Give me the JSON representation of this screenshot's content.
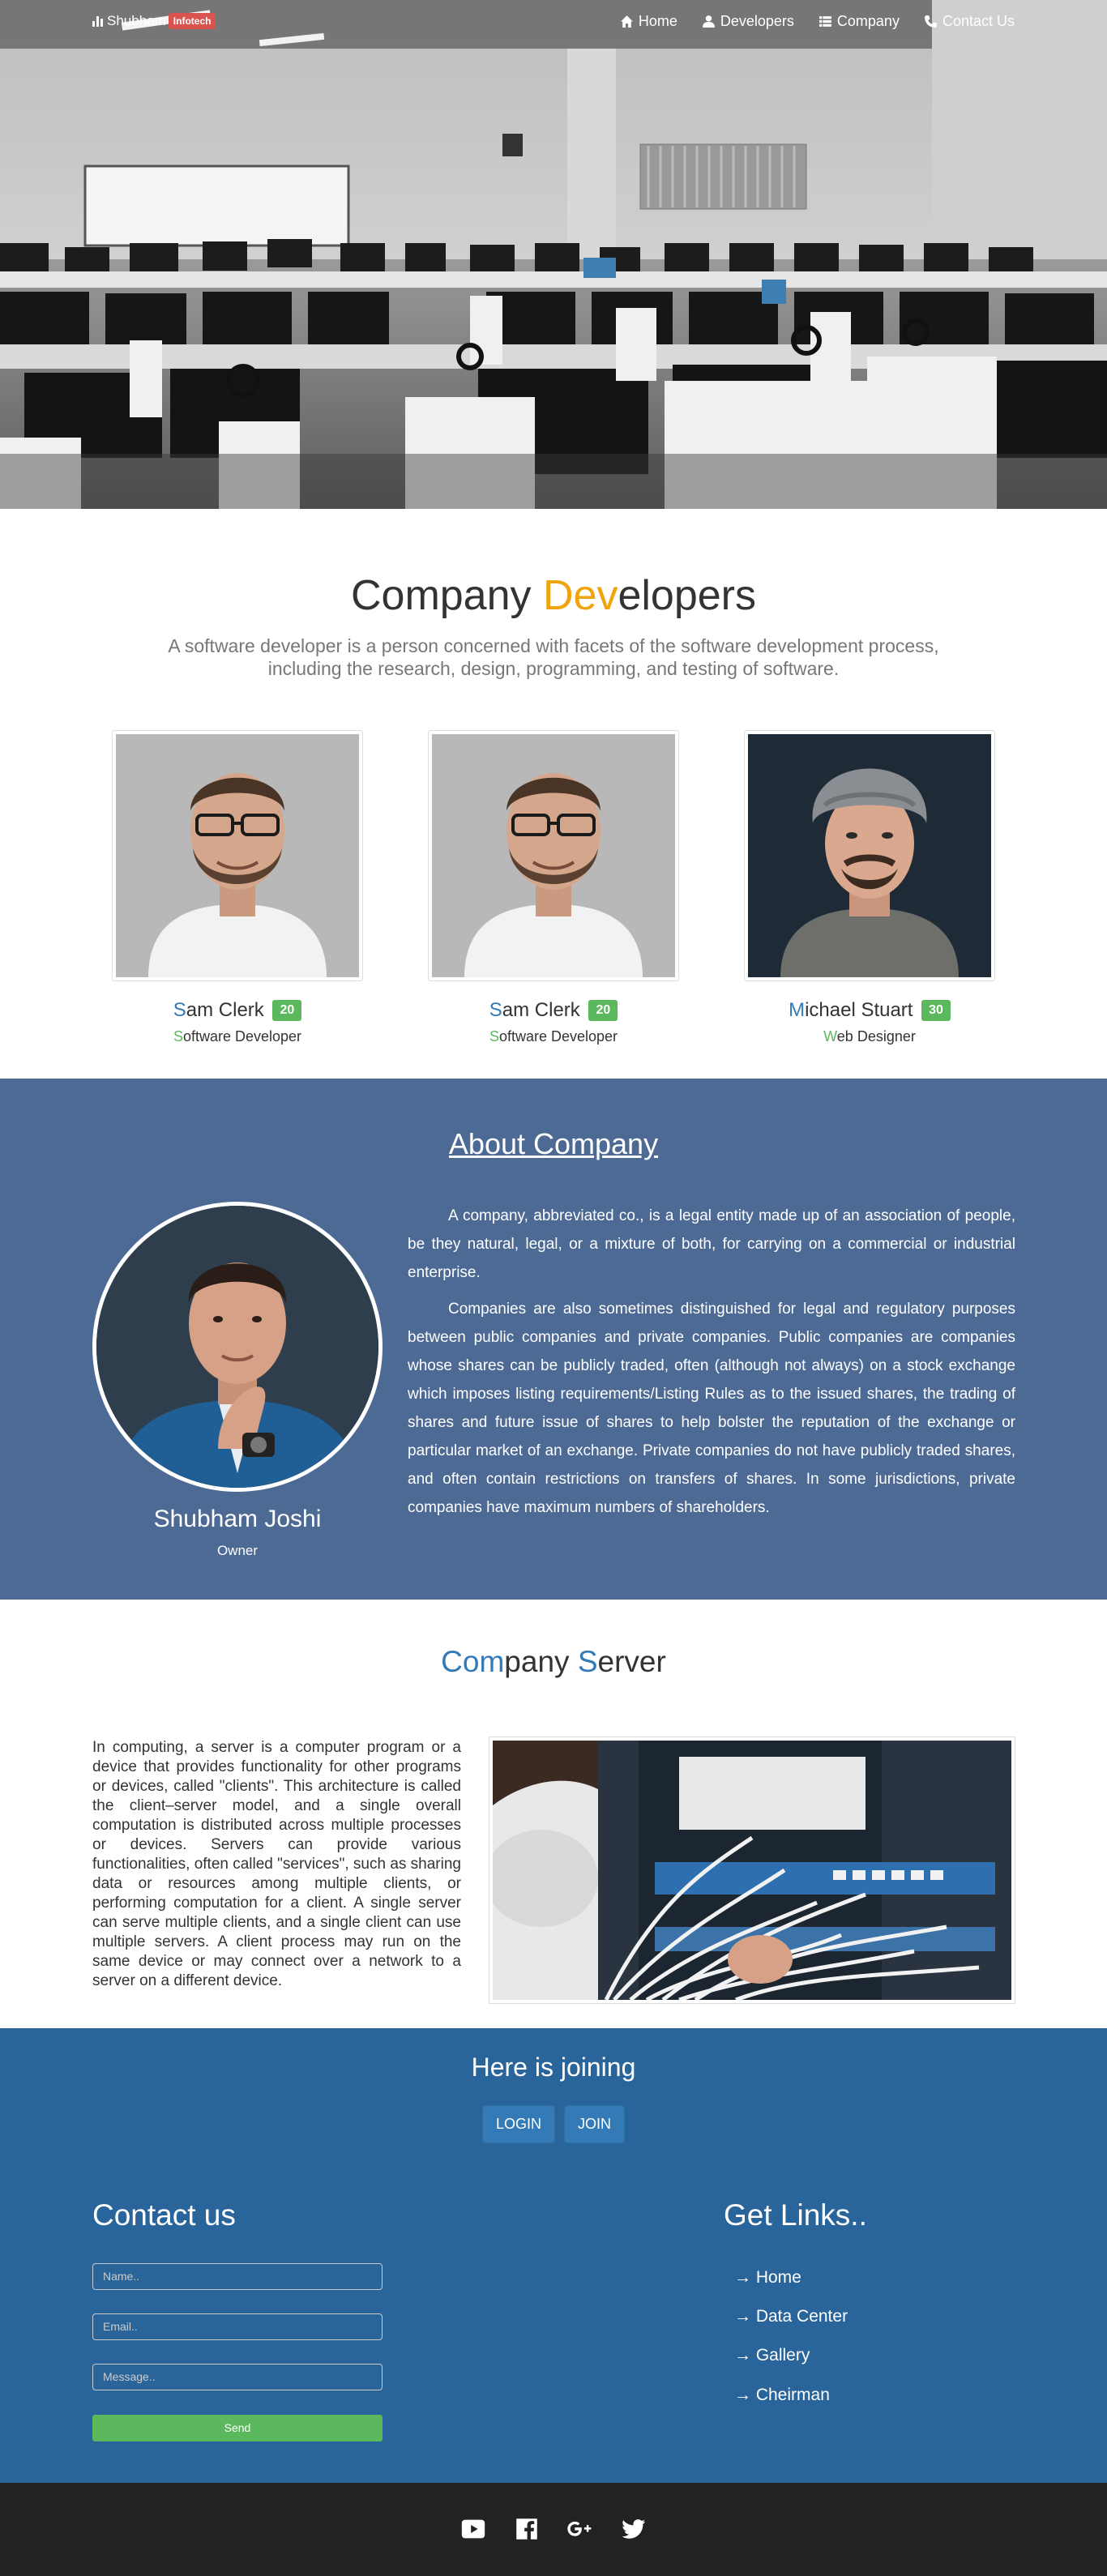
{
  "nav": {
    "brand_name": "Shubham",
    "brand_badge": "Infotech",
    "links": [
      {
        "label": "Home",
        "icon": "home-icon"
      },
      {
        "label": "Developers",
        "icon": "user-icon"
      },
      {
        "label": "Company",
        "icon": "list-icon"
      },
      {
        "label": "Contact Us",
        "icon": "phone-icon"
      }
    ]
  },
  "developers": {
    "title_part1": "Company ",
    "title_accent": "Dev",
    "title_part2": "elopers",
    "subtitle": "A software developer is a person concerned with facets of the software development process, including the research, design, programming, and testing of software.",
    "cards": [
      {
        "name_first": "S",
        "name_rest": "am Clerk",
        "age": "20",
        "role_first": "S",
        "role_rest": "oftware Developer"
      },
      {
        "name_first": "S",
        "name_rest": "am Clerk",
        "age": "20",
        "role_first": "S",
        "role_rest": "oftware Developer"
      },
      {
        "name_first": "M",
        "name_rest": "ichael Stuart",
        "age": "30",
        "role_first": "W",
        "role_rest": "eb Designer"
      }
    ]
  },
  "about": {
    "title": "About Company",
    "owner_name": "Shubham Joshi",
    "owner_role": "Owner",
    "paragraphs": [
      "A company, abbreviated co., is a legal entity made up of an association of people, be they natural, legal, or a mixture of both, for carrying on a commercial or industrial enterprise.",
      "Companies are also sometimes distinguished for legal and regulatory purposes between public companies and private companies. Public companies are companies whose shares can be publicly traded, often (although not always) on a stock exchange which imposes listing requirements/Listing Rules as to the issued shares, the trading of shares and future issue of shares to help bolster the reputation of the exchange or particular market of an exchange. Private companies do not have publicly traded shares, and often contain restrictions on transfers of shares. In some jurisdictions, private companies have maximum numbers of shareholders."
    ]
  },
  "server": {
    "title_a1": "Com",
    "title_b1": "pany ",
    "title_a2": "S",
    "title_b2": "erver",
    "text": "In computing, a server is a computer program or a device that provides functionality for other programs or devices, called \"clients\". This architecture is called the client–server model, and a single overall computation is distributed across multiple processes or devices. Servers can provide various functionalities, often called \"services\", such as sharing data or resources among multiple clients, or performing computation for a client. A single server can serve multiple clients, and a single client can use multiple servers. A client process may run on the same device or may connect over a network to a server on a different device."
  },
  "join": {
    "title": "Here is joining",
    "login_label": "LOGIN",
    "join_label": "JOIN"
  },
  "contact": {
    "title": "Contact us",
    "name_placeholder": "Name..",
    "email_placeholder": "Email..",
    "message_placeholder": "Message..",
    "send_label": "Send"
  },
  "links": {
    "title": "Get Links..",
    "items": [
      "→ Home",
      "→ Data Center",
      "→ Gallery",
      "→ Cheirman"
    ]
  },
  "footer": {
    "socials": [
      "youtube-icon",
      "facebook-icon",
      "google-plus-icon",
      "twitter-icon"
    ]
  },
  "colors": {
    "accent_orange": "#f0a30a",
    "link_blue": "#337ab7",
    "success_green": "#5cb85c",
    "about_bg": "#4d6a95",
    "contact_bg": "#29649a",
    "footer_bg": "#222222",
    "badge_red": "#d9534f"
  }
}
